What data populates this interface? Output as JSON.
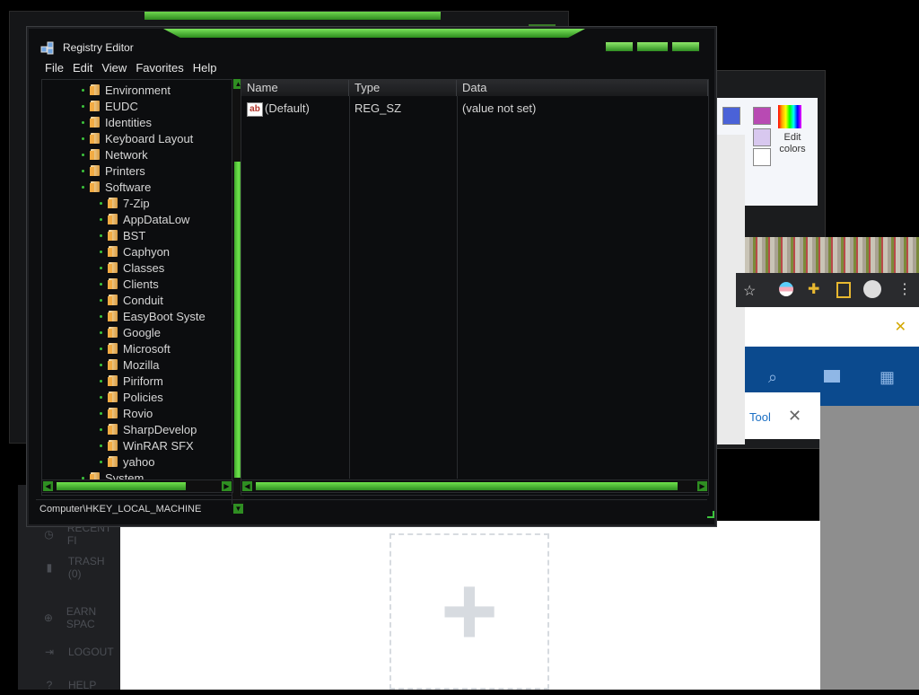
{
  "window": {
    "title": "Registry Editor",
    "menu": [
      "File",
      "Edit",
      "View",
      "Favorites",
      "Help"
    ]
  },
  "tree": {
    "items": [
      {
        "label": "Environment",
        "level": 1
      },
      {
        "label": "EUDC",
        "level": 1
      },
      {
        "label": "Identities",
        "level": 1
      },
      {
        "label": "Keyboard Layout",
        "level": 1
      },
      {
        "label": "Network",
        "level": 1
      },
      {
        "label": "Printers",
        "level": 1
      },
      {
        "label": "Software",
        "level": 1
      },
      {
        "label": "7-Zip",
        "level": 2
      },
      {
        "label": "AppDataLow",
        "level": 2
      },
      {
        "label": "BST",
        "level": 2
      },
      {
        "label": "Caphyon",
        "level": 2
      },
      {
        "label": "Classes",
        "level": 2
      },
      {
        "label": "Clients",
        "level": 2
      },
      {
        "label": "Conduit",
        "level": 2
      },
      {
        "label": "EasyBoot Syste",
        "level": 2
      },
      {
        "label": "Google",
        "level": 2
      },
      {
        "label": "Microsoft",
        "level": 2
      },
      {
        "label": "Mozilla",
        "level": 2
      },
      {
        "label": "Piriform",
        "level": 2
      },
      {
        "label": "Policies",
        "level": 2
      },
      {
        "label": "Rovio",
        "level": 2
      },
      {
        "label": "SharpDevelop",
        "level": 2
      },
      {
        "label": "WinRAR SFX",
        "level": 2
      },
      {
        "label": "yahoo",
        "level": 2
      },
      {
        "label": "System",
        "level": 1
      }
    ]
  },
  "list": {
    "columns": {
      "name": "Name",
      "type": "Type",
      "data": "Data"
    },
    "rows": [
      {
        "name": "(Default)",
        "type": "REG_SZ",
        "data": "(value not set)",
        "icon": "ab-icon"
      }
    ]
  },
  "status": {
    "path": "Computer\\HKEY_LOCAL_MACHINE"
  },
  "background": {
    "paint_edit_colors": "Edit colors",
    "tool_label": "Tool",
    "sidebar": [
      "RECENT FI",
      "TRASH (0)",
      "EARN SPAC",
      "LOGOUT",
      "HELP"
    ]
  },
  "colors": {
    "accent_green": "#3cc43c",
    "window_bg": "#0d0e10",
    "text": "#d6d6d6"
  }
}
